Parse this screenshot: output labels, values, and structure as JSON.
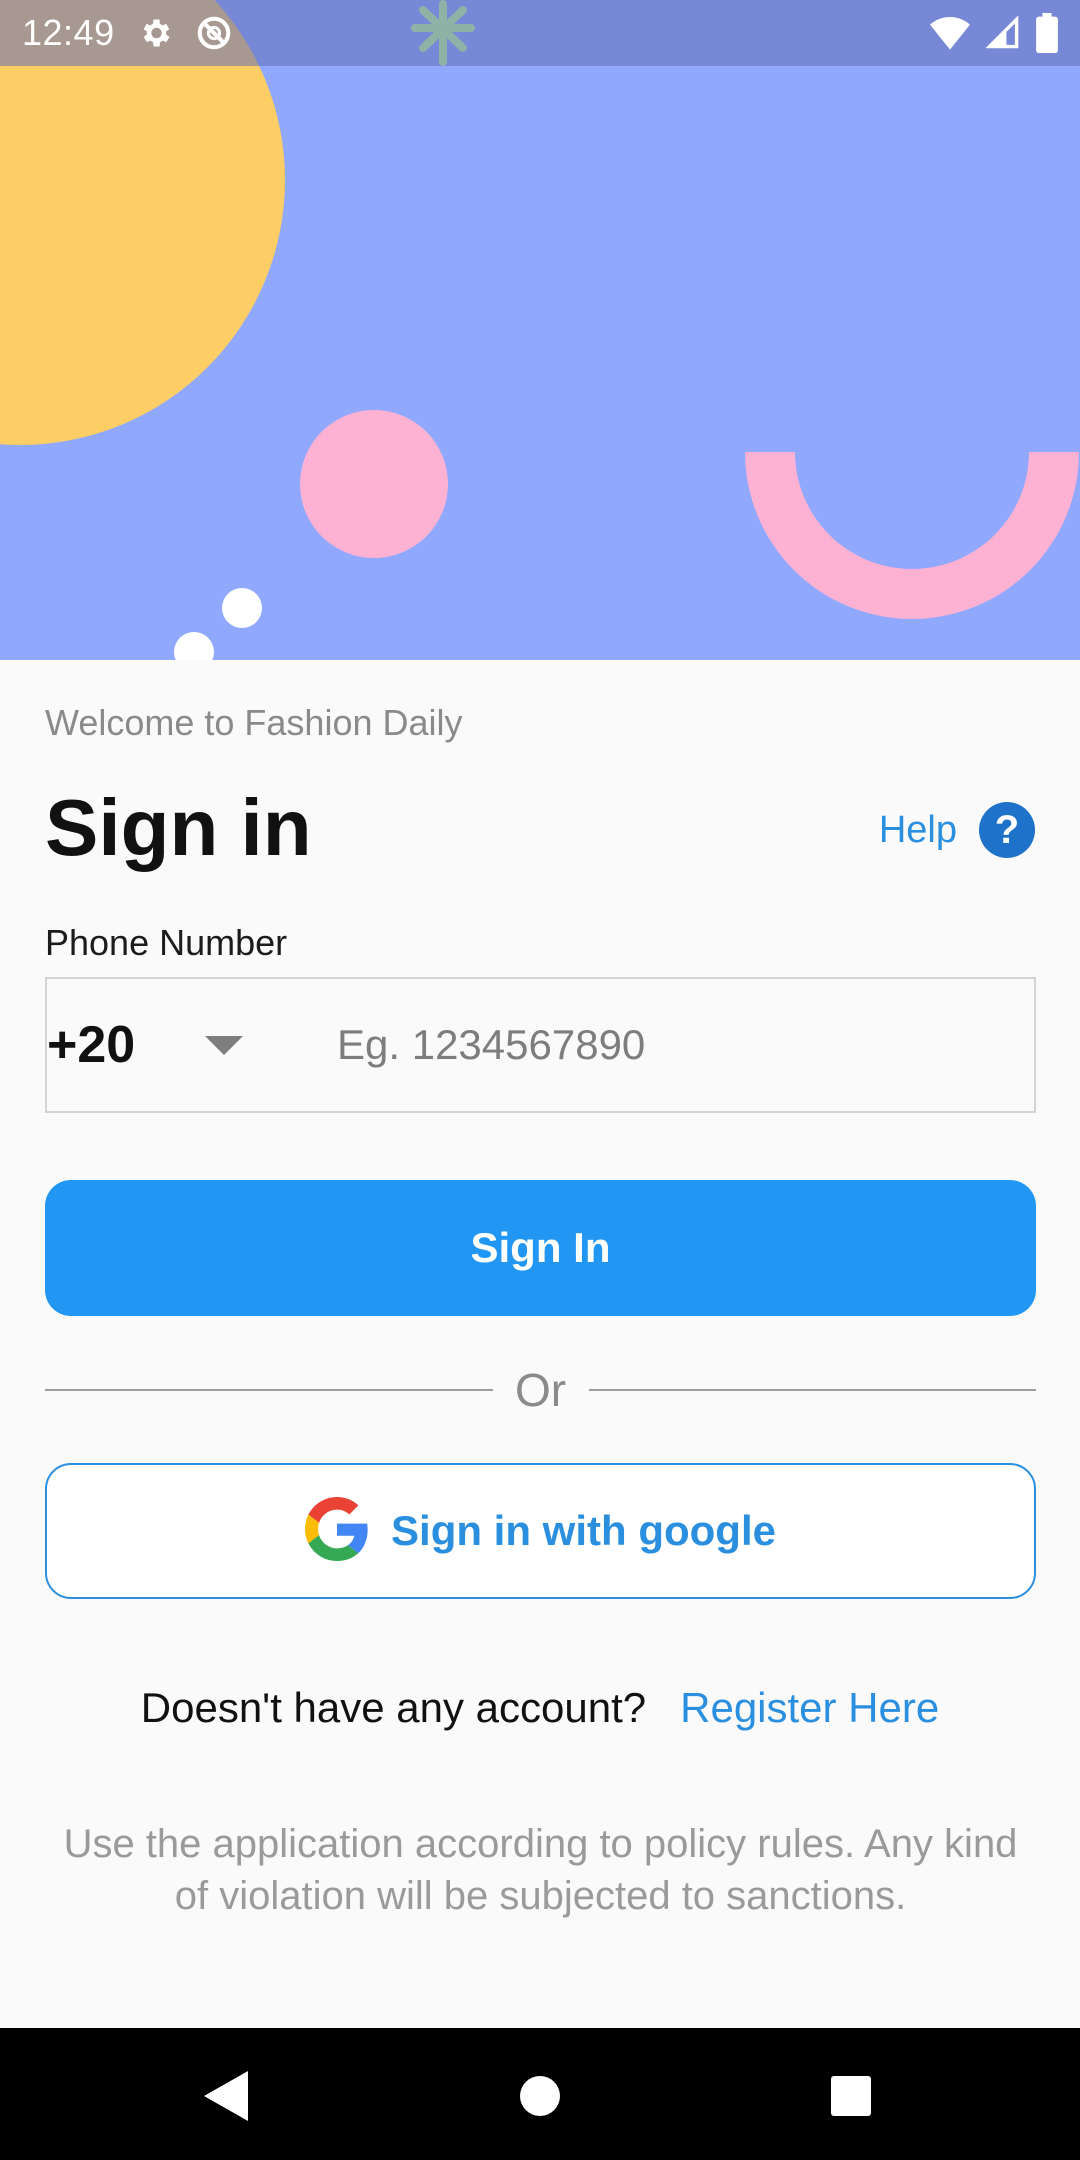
{
  "status_bar": {
    "time": "12:49"
  },
  "header": {
    "welcome": "Welcome to Fashion Daily",
    "title": "Sign in",
    "help_label": "Help",
    "help_icon_glyph": "?"
  },
  "form": {
    "phone_label": "Phone Number",
    "country_code": "+20",
    "phone_placeholder": "Eg. 1234567890",
    "phone_value": ""
  },
  "actions": {
    "sign_in_label": "Sign In",
    "divider_text": "Or",
    "google_label": "Sign in with google"
  },
  "register": {
    "question": "Doesn't have any account?",
    "link": "Register Here"
  },
  "policy": "Use the application according to policy rules. Any kind of violation will be subjected to sanctions.",
  "colors": {
    "hero_background": "#90a8fe",
    "accent_blue": "#2196f3",
    "link_blue": "#2b8fe0",
    "help_icon_blue": "#1f72c9",
    "sun_yellow": "#fdce66",
    "pink": "#fdb2d4"
  },
  "icons": {
    "status_left": [
      "gear-icon",
      "no-sync-icon"
    ],
    "status_right": [
      "wifi-icon",
      "cellular-signal-icon",
      "battery-icon"
    ],
    "nav": [
      "back-icon",
      "home-icon",
      "recents-icon"
    ]
  }
}
